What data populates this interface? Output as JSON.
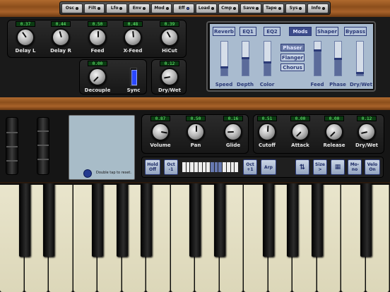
{
  "nav": {
    "items": [
      {
        "label": "Osc",
        "active": false
      },
      {
        "label": "Filt",
        "active": false
      },
      {
        "label": "Lfo",
        "active": false
      },
      {
        "label": "Env",
        "active": false
      },
      {
        "label": "Mod",
        "active": false
      },
      {
        "label": "Eff",
        "active": true
      },
      {
        "label": "Load",
        "active": false
      },
      {
        "label": "Cmp",
        "active": false
      },
      {
        "label": "Save",
        "active": false
      },
      {
        "label": "Tape",
        "active": false
      },
      {
        "label": "Sys",
        "active": false
      },
      {
        "label": "Info",
        "active": false
      }
    ]
  },
  "delay": {
    "knobs": [
      {
        "label": "Delay L",
        "value": "0.37"
      },
      {
        "label": "Delay R",
        "value": "0.44"
      },
      {
        "label": "Feed",
        "value": "0.50"
      },
      {
        "label": "X-Feed",
        "value": "0.48"
      },
      {
        "label": "HiCut",
        "value": "0.39"
      }
    ],
    "decouple": {
      "label": "Decouple",
      "value": "0.00"
    },
    "sync": {
      "label": "Sync",
      "on": true
    },
    "drywet": {
      "label": "Dry/Wet",
      "value": "0.12"
    }
  },
  "fx": {
    "tabs": [
      {
        "label": "Reverb",
        "active": false
      },
      {
        "label": "EQ1",
        "active": false
      },
      {
        "label": "EQ2",
        "active": false
      },
      {
        "label": "Mods",
        "active": true
      },
      {
        "label": "Shaper",
        "active": false
      },
      {
        "label": "Bypass",
        "active": false
      }
    ],
    "modes": [
      {
        "label": "Phaser",
        "active": true
      },
      {
        "label": "Flanger",
        "active": false
      },
      {
        "label": "Chorus",
        "active": false
      }
    ],
    "sliders": [
      {
        "label": "Speed",
        "level": 0.22
      },
      {
        "label": "Depth",
        "level": 0.5
      },
      {
        "label": "Color",
        "level": 0.38
      },
      {
        "label": "Feed",
        "level": 0.72
      },
      {
        "label": "Phase",
        "level": 0.48
      },
      {
        "label": "Dry/Wet",
        "level": 0.06
      }
    ]
  },
  "main": {
    "knobs": [
      {
        "label": "Volume",
        "value": "0.87"
      },
      {
        "label": "Pan",
        "value": "0.50"
      },
      {
        "label": "Glide",
        "value": "0.16"
      }
    ]
  },
  "filter": {
    "knobs": [
      {
        "label": "Cutoff",
        "value": "0.51"
      },
      {
        "label": "Attack",
        "value": "0.00"
      },
      {
        "label": "Release",
        "value": "0.00"
      },
      {
        "label": "Dry/Wet",
        "value": "0.12"
      }
    ]
  },
  "xypad": {
    "hint": "Double tap to reset."
  },
  "controls": {
    "hold": "Hold Off",
    "oct_down": "Oct -1",
    "oct_up": "Oct +1",
    "arp": "Arp",
    "size": "Size >",
    "mono": "Mo- no",
    "velo": "Velo On"
  }
}
